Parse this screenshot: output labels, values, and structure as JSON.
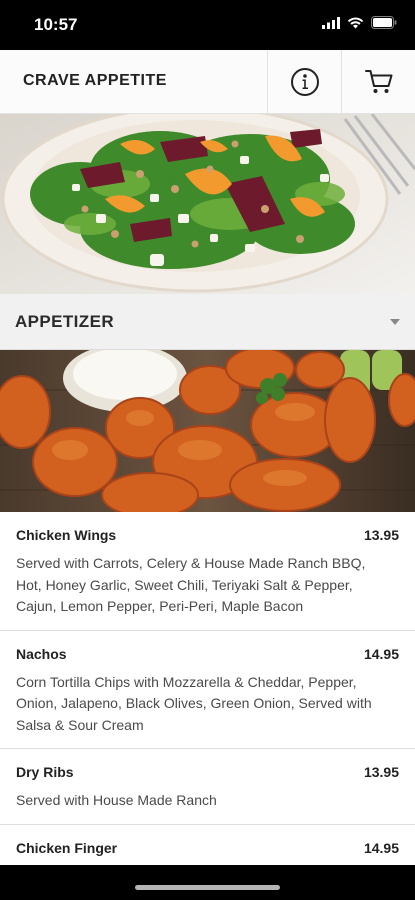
{
  "status_bar": {
    "time": "10:57",
    "icons": [
      "signal-icon",
      "wifi-icon",
      "battery-icon"
    ]
  },
  "header": {
    "title": "CRAVE APPETITE",
    "info_icon": "info-icon",
    "cart_icon": "cart-icon"
  },
  "category": {
    "title": "APPETIZER",
    "caret_icon": "caret-down-icon"
  },
  "menu_items": [
    {
      "name": "Chicken Wings",
      "price": "13.95",
      "description": "Served with Carrots, Celery & House Made Ranch BBQ, Hot, Honey Garlic, Sweet Chili, Teriyaki Salt & Pepper, Cajun, Lemon Pepper, Peri-Peri, Maple Bacon"
    },
    {
      "name": "Nachos",
      "price": "14.95",
      "description": "Corn Tortilla Chips with Mozzarella & Cheddar, Pepper, Onion, Jalapeno, Black Olives, Green Onion, Served with Salsa & Sour Cream"
    },
    {
      "name": "Dry Ribs",
      "price": "13.95",
      "description": "Served with House Made Ranch"
    },
    {
      "name": "Chicken Finger",
      "price": "14.95",
      "description": ""
    }
  ],
  "colors": {
    "header_bg": "#fbfbfb",
    "category_bg": "#f1f1f1",
    "text": "#222222",
    "wing_orange": "#d2601f"
  }
}
